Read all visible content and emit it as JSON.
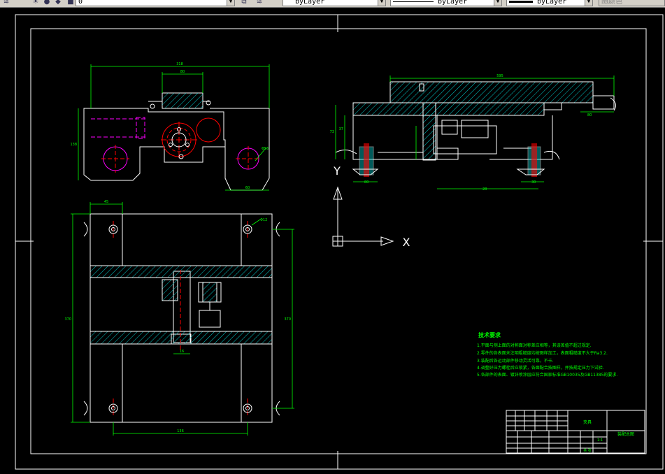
{
  "toolbar": {
    "layer_value": "0",
    "color_value": "byLayer",
    "linetype_value": "byLayer",
    "lineweight_value": "byLayer",
    "plotstyle_value": "随颜色"
  },
  "ucs": {
    "x_label": "X",
    "y_label": "Y"
  },
  "dimensions": {
    "top_view_width": "318",
    "top_view_inner": "80",
    "top_view_height": "138",
    "top_view_bottom": "60",
    "top_view_dia": "Φ56",
    "side_length": "595",
    "side_h1": "73",
    "side_h2": "37",
    "side_right": "80",
    "side_bottom_left": "80",
    "side_bottom_mid": "28",
    "side_bottom_right": "30",
    "plan_top": "45",
    "plan_height": "370",
    "plan_right": "370",
    "plan_bottom": "136",
    "plan_slot": "16",
    "plan_hole": "Φ12"
  },
  "notes": {
    "title": "技术要求",
    "lines": [
      "1.平面与侧上面的对称面对称差应相等，其误差值不超过规定.",
      "2.零件的各表面未注明粗糙度均按图样加工，表面粗糙度不大于Ra3.2.",
      "3.装配后各运动部件移动灵活可靠，不卡.",
      "4.调整好压力螺栓后应锁紧，各面配合按图样，并按规定压力下试验.",
      "5.各部件的表面、镀锌喷涂层应符合国家标准GB10035及GB11385的要求."
    ]
  },
  "title_block": {
    "name": "夹具",
    "drawing": "装配总图",
    "scale": "1:1",
    "sheet": "共 张"
  }
}
